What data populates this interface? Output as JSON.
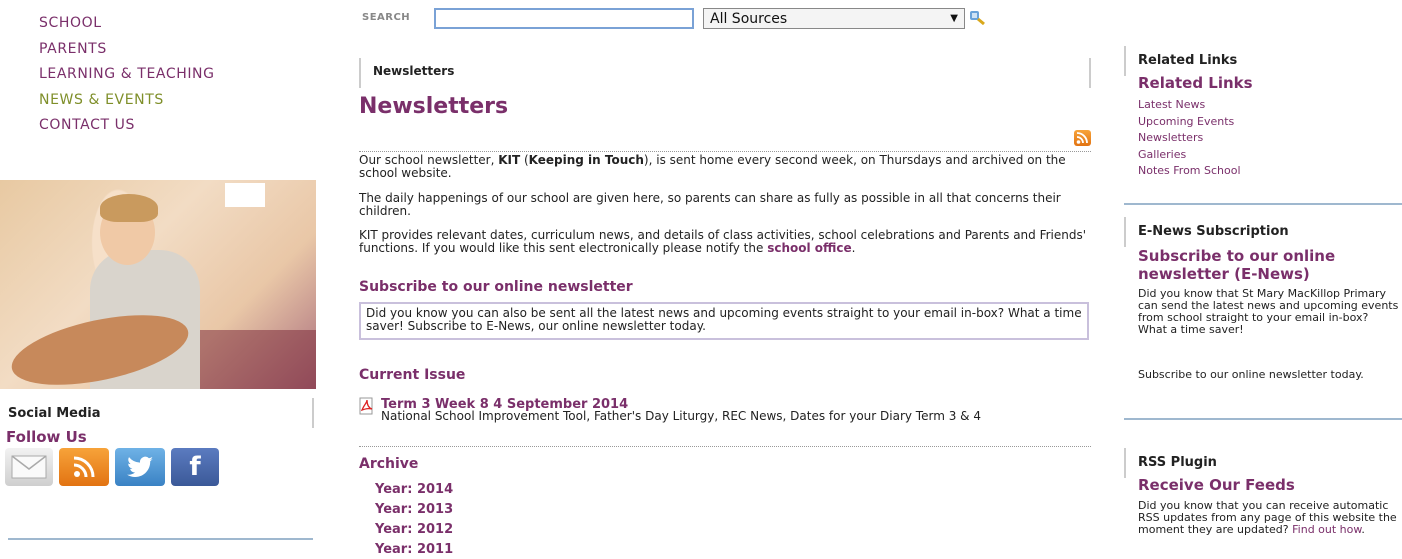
{
  "nav": {
    "items": [
      "SCHOOL",
      "PARENTS",
      "LEARNING & TEACHING",
      "NEWS & EVENTS",
      "CONTACT US"
    ],
    "active_index": 3
  },
  "search": {
    "label": "SEARCH",
    "value": "",
    "source_selected": "All Sources"
  },
  "social": {
    "title": "Social Media",
    "subtitle": "Follow Us",
    "icons": [
      "mail-icon",
      "rss-icon",
      "twitter-icon",
      "facebook-icon"
    ]
  },
  "main": {
    "breadcrumb": "Newsletters",
    "title": "Newsletters",
    "intro": {
      "p1_a": "Our school newsletter, ",
      "p1_kit": "KIT",
      "p1_b": " (",
      "p1_kit_full": "Keeping in Touch",
      "p1_c": "), is sent home every second week, on Thursdays and archived on the school website.",
      "p2": "The daily happenings of our school are given here, so parents can share as fully as possible in all that concerns their children.",
      "p3": "KIT provides relevant dates, curriculum news, and details of class activities, school celebrations and Parents and Friends' functions. If you would like this sent electronically please notify the ",
      "p3_link": "school office",
      "p3_end": "."
    },
    "subscribe": {
      "heading": "Subscribe to our online newsletter",
      "text": "Did you know you can also be sent all the latest news and upcoming events straight to your email in-box? What a time saver! Subscribe to E-News, our online newsletter today."
    },
    "current_issue": {
      "heading": "Current Issue",
      "title": "Term 3 Week 8 4 September 2014",
      "desc": "National School Improvement Tool, Father's Day Liturgy, REC News, Dates for your Diary Term 3 & 4"
    },
    "archive": {
      "heading": "Archive",
      "years": [
        "Year: 2014",
        "Year: 2013",
        "Year: 2012",
        "Year: 2011"
      ]
    }
  },
  "sidebar": {
    "related": {
      "label": "Related Links",
      "heading": "Related Links",
      "links": [
        "Latest News",
        "Upcoming Events",
        "Newsletters",
        "Galleries",
        "Notes From School"
      ]
    },
    "enews": {
      "label": "E-News Subscription",
      "heading": "Subscribe to our online newsletter (E-News)",
      "text": "Did you know that St Mary MacKillop Primary can send the latest news and upcoming events from school straight to your email in-box? What a time saver!",
      "text2": "Subscribe to our online newsletter today."
    },
    "rss": {
      "label": "RSS Plugin",
      "heading": "Receive Our Feeds",
      "text": "Did you know that you can receive automatic RSS updates from any page of this website the moment they are updated? ",
      "link": "Find out how",
      "end": "."
    }
  },
  "colors": {
    "accent": "#7a2f6a",
    "active_nav": "#7f8f2a",
    "divider": "#9fb8cf"
  }
}
